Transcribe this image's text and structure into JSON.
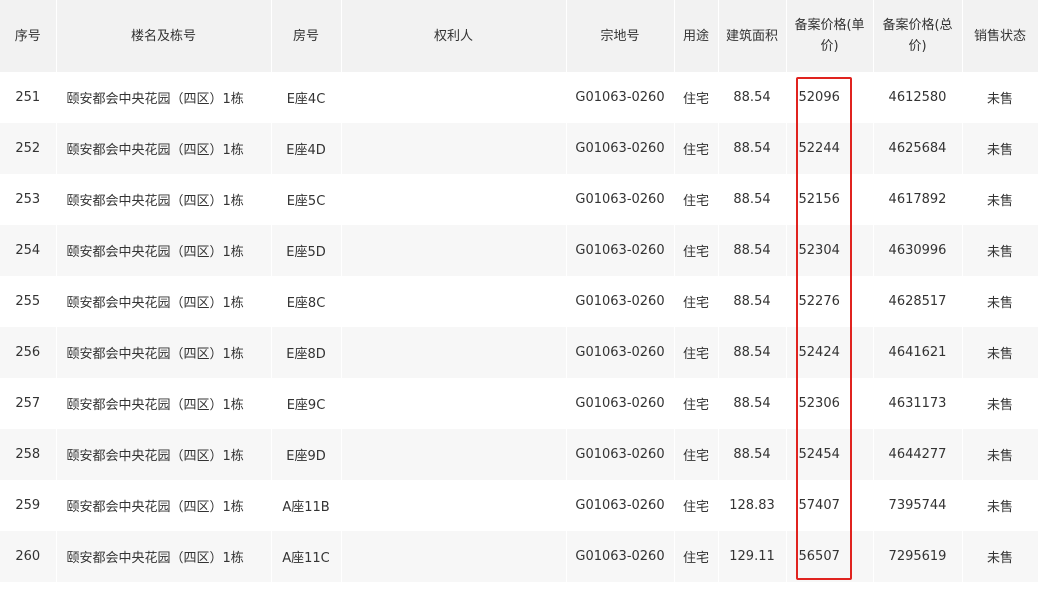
{
  "table": {
    "headers": {
      "no": "序号",
      "building": "楼名及栋号",
      "room": "房号",
      "owner": "权利人",
      "parcel": "宗地号",
      "usage": "用途",
      "area": "建筑面积",
      "unit_price_line1": "备案价格(单",
      "unit_price_line2": "价)",
      "total_price_line1": "备案价格(总",
      "total_price_line2": "价)",
      "status": "销售状态"
    },
    "rows": [
      {
        "no": "251",
        "building": "颐安都会中央花园（四区）1栋",
        "room": "E座4C",
        "owner": "",
        "parcel": "G01063-0260",
        "usage": "住宅",
        "area": "88.54",
        "unit_price": "52096",
        "total_price": "4612580",
        "status": "未售"
      },
      {
        "no": "252",
        "building": "颐安都会中央花园（四区）1栋",
        "room": "E座4D",
        "owner": "",
        "parcel": "G01063-0260",
        "usage": "住宅",
        "area": "88.54",
        "unit_price": "52244",
        "total_price": "4625684",
        "status": "未售"
      },
      {
        "no": "253",
        "building": "颐安都会中央花园（四区）1栋",
        "room": "E座5C",
        "owner": "",
        "parcel": "G01063-0260",
        "usage": "住宅",
        "area": "88.54",
        "unit_price": "52156",
        "total_price": "4617892",
        "status": "未售"
      },
      {
        "no": "254",
        "building": "颐安都会中央花园（四区）1栋",
        "room": "E座5D",
        "owner": "",
        "parcel": "G01063-0260",
        "usage": "住宅",
        "area": "88.54",
        "unit_price": "52304",
        "total_price": "4630996",
        "status": "未售"
      },
      {
        "no": "255",
        "building": "颐安都会中央花园（四区）1栋",
        "room": "E座8C",
        "owner": "",
        "parcel": "G01063-0260",
        "usage": "住宅",
        "area": "88.54",
        "unit_price": "52276",
        "total_price": "4628517",
        "status": "未售"
      },
      {
        "no": "256",
        "building": "颐安都会中央花园（四区）1栋",
        "room": "E座8D",
        "owner": "",
        "parcel": "G01063-0260",
        "usage": "住宅",
        "area": "88.54",
        "unit_price": "52424",
        "total_price": "4641621",
        "status": "未售"
      },
      {
        "no": "257",
        "building": "颐安都会中央花园（四区）1栋",
        "room": "E座9C",
        "owner": "",
        "parcel": "G01063-0260",
        "usage": "住宅",
        "area": "88.54",
        "unit_price": "52306",
        "total_price": "4631173",
        "status": "未售"
      },
      {
        "no": "258",
        "building": "颐安都会中央花园（四区）1栋",
        "room": "E座9D",
        "owner": "",
        "parcel": "G01063-0260",
        "usage": "住宅",
        "area": "88.54",
        "unit_price": "52454",
        "total_price": "4644277",
        "status": "未售"
      },
      {
        "no": "259",
        "building": "颐安都会中央花园（四区）1栋",
        "room": "A座11B",
        "owner": "",
        "parcel": "G01063-0260",
        "usage": "住宅",
        "area": "128.83",
        "unit_price": "57407",
        "total_price": "7395744",
        "status": "未售"
      },
      {
        "no": "260",
        "building": "颐安都会中央花园（四区）1栋",
        "room": "A座11C",
        "owner": "",
        "parcel": "G01063-0260",
        "usage": "住宅",
        "area": "129.11",
        "unit_price": "56507",
        "total_price": "7295619",
        "status": "未售"
      }
    ]
  },
  "colors": {
    "header_bg": "#f2f2f2",
    "stripe_bg": "#f7f7f7",
    "highlight_border": "#e0231f"
  }
}
